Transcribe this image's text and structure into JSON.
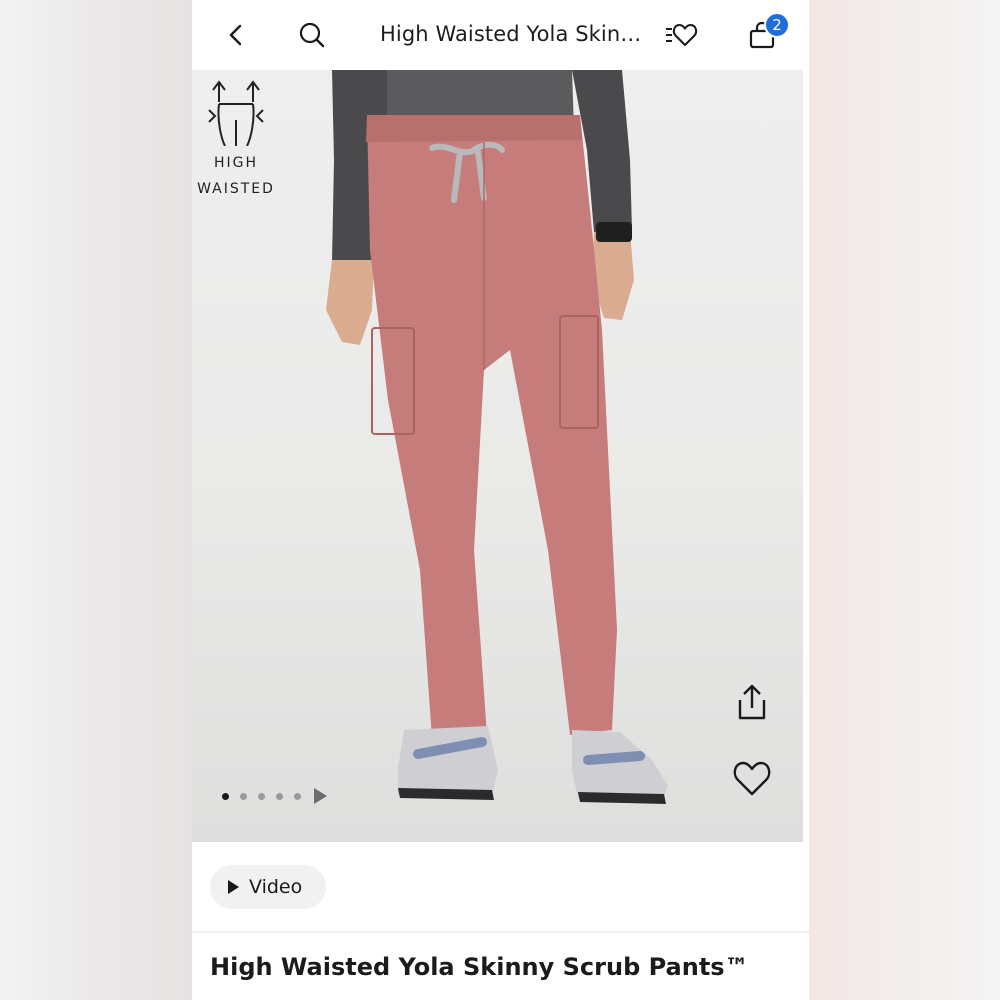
{
  "header": {
    "title": "High Waisted Yola Skin…",
    "bag_count": "2",
    "icons": [
      "chevron-left-icon",
      "search-icon",
      "wishlist-icon",
      "shopping-bag-icon"
    ]
  },
  "hero": {
    "badge_line1": "HIGH",
    "badge_line2": "WAISTED",
    "carousel_total": 5,
    "carousel_active": 1
  },
  "video": {
    "label": "Video"
  },
  "product": {
    "name": "High Waisted Yola Skinny Scrub Pants™"
  },
  "colors": {
    "badge": "#1f6ee0",
    "pants": "#c57c7a",
    "shirt": "#4a4a4d"
  }
}
